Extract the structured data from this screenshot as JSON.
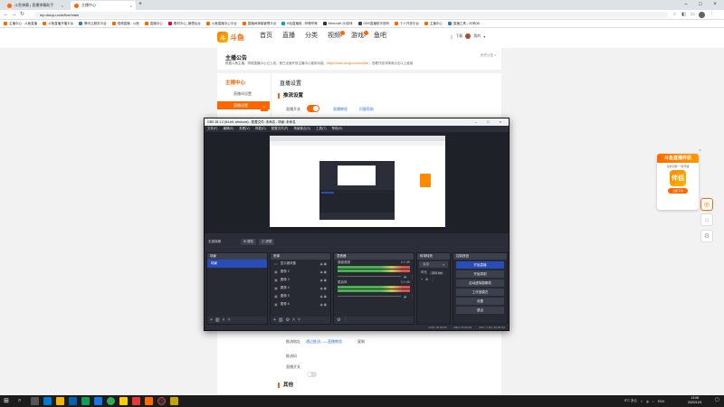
{
  "browser": {
    "tabs": [
      {
        "title": "斗鱼弹幕 | 直播弹幕助手",
        "active": false
      },
      {
        "title": "主播中心",
        "active": true
      }
    ],
    "url": "mp.douyu.com/live/main",
    "bookmarks": [
      "主播中心 - 斗鱼直播",
      "斗鱼直播开播平台",
      "腾讯云服务平台",
      "视频直播 - 斗鱼",
      "直播中心",
      "素材中心_管理后台",
      "斗鱼直播中心平台",
      "直播间弹幕管理平台",
      "B站直播姬 - 哔哩哔哩",
      "Minecraft 2D游戏",
      "OBS直播助手官网",
      "个人开放平台",
      "主播中心",
      "直播工具 - 2D转3D"
    ]
  },
  "site": {
    "logo_text": "斗鱼",
    "logo_mark": "斗",
    "nav": [
      "首页",
      "直播",
      "分类",
      "视频",
      "游戏",
      "鱼吧"
    ],
    "user_download": "下载",
    "user_name": "我的"
  },
  "announcement": {
    "title": "主播公告",
    "text_pre": "根据斗鱼主播、举报直播中心已上线，现已全面开放主播中心使用功能。",
    "link": "https://www.douyu.com/notice",
    "text_post": "查看开放详情请点击以上链接",
    "history": "历史公告 >"
  },
  "sidebar": {
    "title": "主播中心",
    "items": [
      "直播间设置",
      "直播设置"
    ]
  },
  "content": {
    "title": "直播设置",
    "section1": "推流设置",
    "stream_label": "直播开关",
    "link_a": "直播教程",
    "link_b": "问题帮助",
    "source_label": "推流地址",
    "source_link": "通过推流——直播教程",
    "source_extra": "复制",
    "auto_label": "推流码",
    "auto2_label": "直播开关",
    "section2": "其他"
  },
  "float_card": {
    "header": "斗鱼直播伴侣",
    "sub": "全新功能 一键开播",
    "icon_text": "伴侣",
    "button": "立即下载"
  },
  "obs": {
    "title": "OBS 28.1.2 (64-bit, windows) - 配置文件: 未命名 - 场景: 未命名",
    "menu": [
      "文件(F)",
      "编辑(E)",
      "查看(V)",
      "停靠(D)",
      "配置文件(P)",
      "场景集合(S)",
      "工具(T)",
      "帮助(H)"
    ],
    "ctrl_label": "无选择源",
    "ctrl_props": "属性",
    "ctrl_filters": "滤镜",
    "scenes_title": "场景",
    "scene_items": [
      "场景"
    ],
    "sources_title": "来源",
    "sources": [
      "显示器采集",
      "图像 2",
      "图像 3",
      "图像 4",
      "图像 5",
      "图像 6"
    ],
    "mixer_title": "混音器",
    "mixer": [
      {
        "name": "桌面音频",
        "db": "0.0 dB"
      },
      {
        "name": "麦克风",
        "db": "0.0 dB"
      }
    ],
    "transitions_title": "转场特效",
    "transition_type": "淡出",
    "transition_duration_label": "时长",
    "transition_duration": "300 ms",
    "controls_title": "控制按钮",
    "controls": [
      "开始直播",
      "开始录制",
      "启动虚拟摄像机",
      "工作室模式",
      "设置",
      "退出"
    ],
    "status": [
      "LIVE: 00:00:00",
      "REC: 00:00:00",
      "CPU: 1.3%, 60.00 fps"
    ]
  },
  "taskbar": {
    "weather": "8°C 多云",
    "lang": "ENG",
    "time": "13:06",
    "date": "2022/12/1"
  }
}
